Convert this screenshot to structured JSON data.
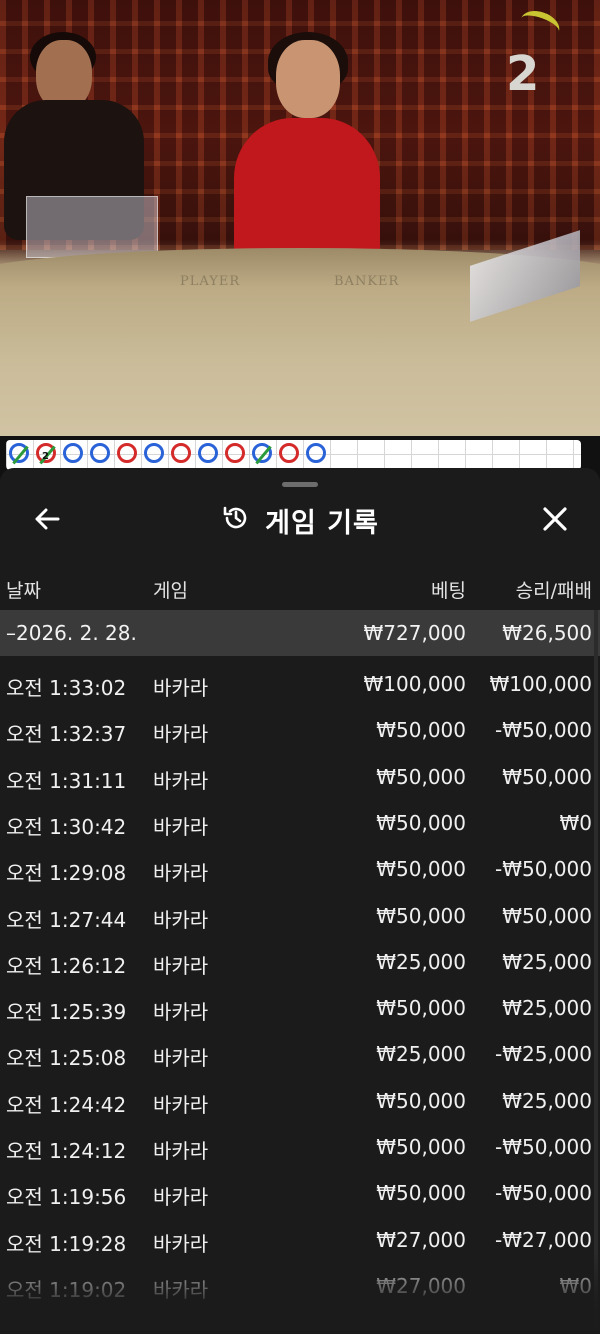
{
  "video": {
    "timer": "2",
    "felt_left": "PLAYER",
    "felt_right": "BANKER"
  },
  "roadmap": {
    "beads": [
      {
        "color": "#2a62d8",
        "slash": true,
        "num": ""
      },
      {
        "color": "#d42a2a",
        "slash": true,
        "num": "2"
      },
      {
        "color": "#2a62d8",
        "slash": false,
        "num": ""
      },
      {
        "color": "#2a62d8",
        "slash": false,
        "num": ""
      },
      {
        "color": "#d42a2a",
        "slash": false,
        "num": ""
      },
      {
        "color": "#2a62d8",
        "slash": false,
        "num": ""
      },
      {
        "color": "#d42a2a",
        "slash": false,
        "num": ""
      },
      {
        "color": "#2a62d8",
        "slash": false,
        "num": ""
      },
      {
        "color": "#d42a2a",
        "slash": false,
        "num": ""
      },
      {
        "color": "#2a62d8",
        "slash": true,
        "num": ""
      },
      {
        "color": "#d42a2a",
        "slash": false,
        "num": ""
      },
      {
        "color": "#2a62d8",
        "slash": false,
        "num": ""
      }
    ]
  },
  "sheet": {
    "title": "게임 기록",
    "back_icon": "arrow-left-icon",
    "history_icon": "history-icon",
    "close_icon": "close-icon"
  },
  "table": {
    "headers": {
      "date": "날짜",
      "game": "게임",
      "bet": "베팅",
      "result": "승리/패배"
    },
    "date_group": {
      "date": "–2026. 2. 28.",
      "bet": "₩727,000",
      "result": "₩26,500"
    },
    "rows": [
      {
        "time": "오전 1:33:02",
        "game": "바카라",
        "bet": "₩100,000",
        "result": "₩100,000"
      },
      {
        "time": "오전 1:32:37",
        "game": "바카라",
        "bet": "₩50,000",
        "result": "-₩50,000"
      },
      {
        "time": "오전 1:31:11",
        "game": "바카라",
        "bet": "₩50,000",
        "result": "₩50,000"
      },
      {
        "time": "오전 1:30:42",
        "game": "바카라",
        "bet": "₩50,000",
        "result": "₩0"
      },
      {
        "time": "오전 1:29:08",
        "game": "바카라",
        "bet": "₩50,000",
        "result": "-₩50,000"
      },
      {
        "time": "오전 1:27:44",
        "game": "바카라",
        "bet": "₩50,000",
        "result": "₩50,000"
      },
      {
        "time": "오전 1:26:12",
        "game": "바카라",
        "bet": "₩25,000",
        "result": "₩25,000"
      },
      {
        "time": "오전 1:25:39",
        "game": "바카라",
        "bet": "₩50,000",
        "result": "₩25,000"
      },
      {
        "time": "오전 1:25:08",
        "game": "바카라",
        "bet": "₩25,000",
        "result": "-₩25,000"
      },
      {
        "time": "오전 1:24:42",
        "game": "바카라",
        "bet": "₩50,000",
        "result": "₩25,000"
      },
      {
        "time": "오전 1:24:12",
        "game": "바카라",
        "bet": "₩50,000",
        "result": "-₩50,000"
      },
      {
        "time": "오전 1:19:56",
        "game": "바카라",
        "bet": "₩50,000",
        "result": "-₩50,000"
      },
      {
        "time": "오전 1:19:28",
        "game": "바카라",
        "bet": "₩27,000",
        "result": "-₩27,000"
      },
      {
        "time": "오전 1:19:02",
        "game": "바카라",
        "bet": "₩27,000",
        "result": "₩0"
      }
    ]
  }
}
